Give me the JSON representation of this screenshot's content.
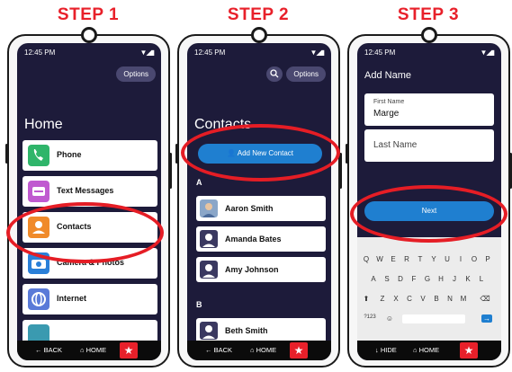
{
  "steps": [
    "STEP 1",
    "STEP 2",
    "STEP 3"
  ],
  "status_time": "12:45 PM",
  "options_label": "Options",
  "bottom_nav": {
    "back": "← BACK",
    "home": "HOME",
    "hide": "HIDE"
  },
  "screen1": {
    "title": "Home",
    "items": [
      {
        "label": "Phone",
        "icon": "phone-icon",
        "color": "#2fb56a"
      },
      {
        "label": "Text Messages",
        "icon": "message-icon",
        "color": "#c05ad0"
      },
      {
        "label": "Contacts",
        "icon": "contacts-icon",
        "color": "#f08a2a"
      },
      {
        "label": "Camera & Photos",
        "icon": "camera-icon",
        "color": "#2a7fd8"
      },
      {
        "label": "Internet",
        "icon": "globe-icon",
        "color": "#5a7ad8"
      }
    ]
  },
  "screen2": {
    "title": "Contacts",
    "add_button": "Add New Contact",
    "section_a": "A",
    "section_b": "B",
    "contacts": [
      "Aaron Smith",
      "Amanda Bates",
      "Amy Johnson"
    ],
    "contacts_b": [
      "Beth Smith"
    ]
  },
  "screen3": {
    "title": "Add Name",
    "first_name_label": "First Name",
    "first_name_value": "Marge",
    "last_name_placeholder": "Last Name",
    "next_button": "Next",
    "keyboard_rows": [
      [
        "Q",
        "W",
        "E",
        "R",
        "T",
        "Y",
        "U",
        "I",
        "O",
        "P"
      ],
      [
        "A",
        "S",
        "D",
        "F",
        "G",
        "H",
        "J",
        "K",
        "L"
      ],
      [
        "Z",
        "X",
        "C",
        "V",
        "B",
        "N",
        "M"
      ]
    ],
    "keyboard_numbers": "?123"
  },
  "colors": {
    "accent_red": "#e8202a",
    "screen_bg": "#1d1b3a",
    "blue": "#1f7fd0"
  }
}
